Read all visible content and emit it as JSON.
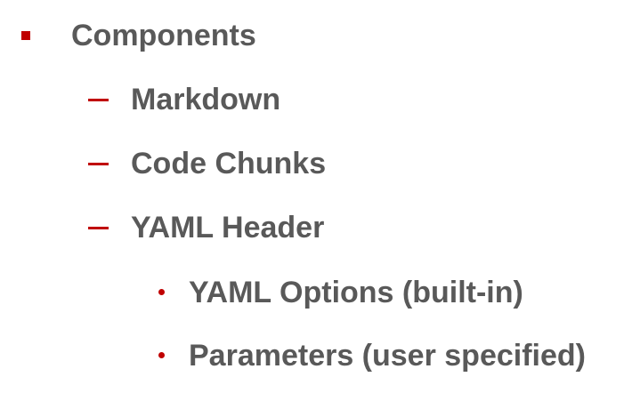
{
  "slide": {
    "items": [
      {
        "level": 1,
        "text": "Components"
      },
      {
        "level": 2,
        "text": "Markdown"
      },
      {
        "level": 2,
        "text": "Code Chunks"
      },
      {
        "level": 2,
        "text": "YAML Header"
      },
      {
        "level": 3,
        "text": "YAML Options (built-in)"
      },
      {
        "level": 3,
        "text": "Parameters (user specified)"
      }
    ]
  },
  "colors": {
    "bullet": "#c00000",
    "text": "#595959",
    "background": "#ffffff"
  }
}
